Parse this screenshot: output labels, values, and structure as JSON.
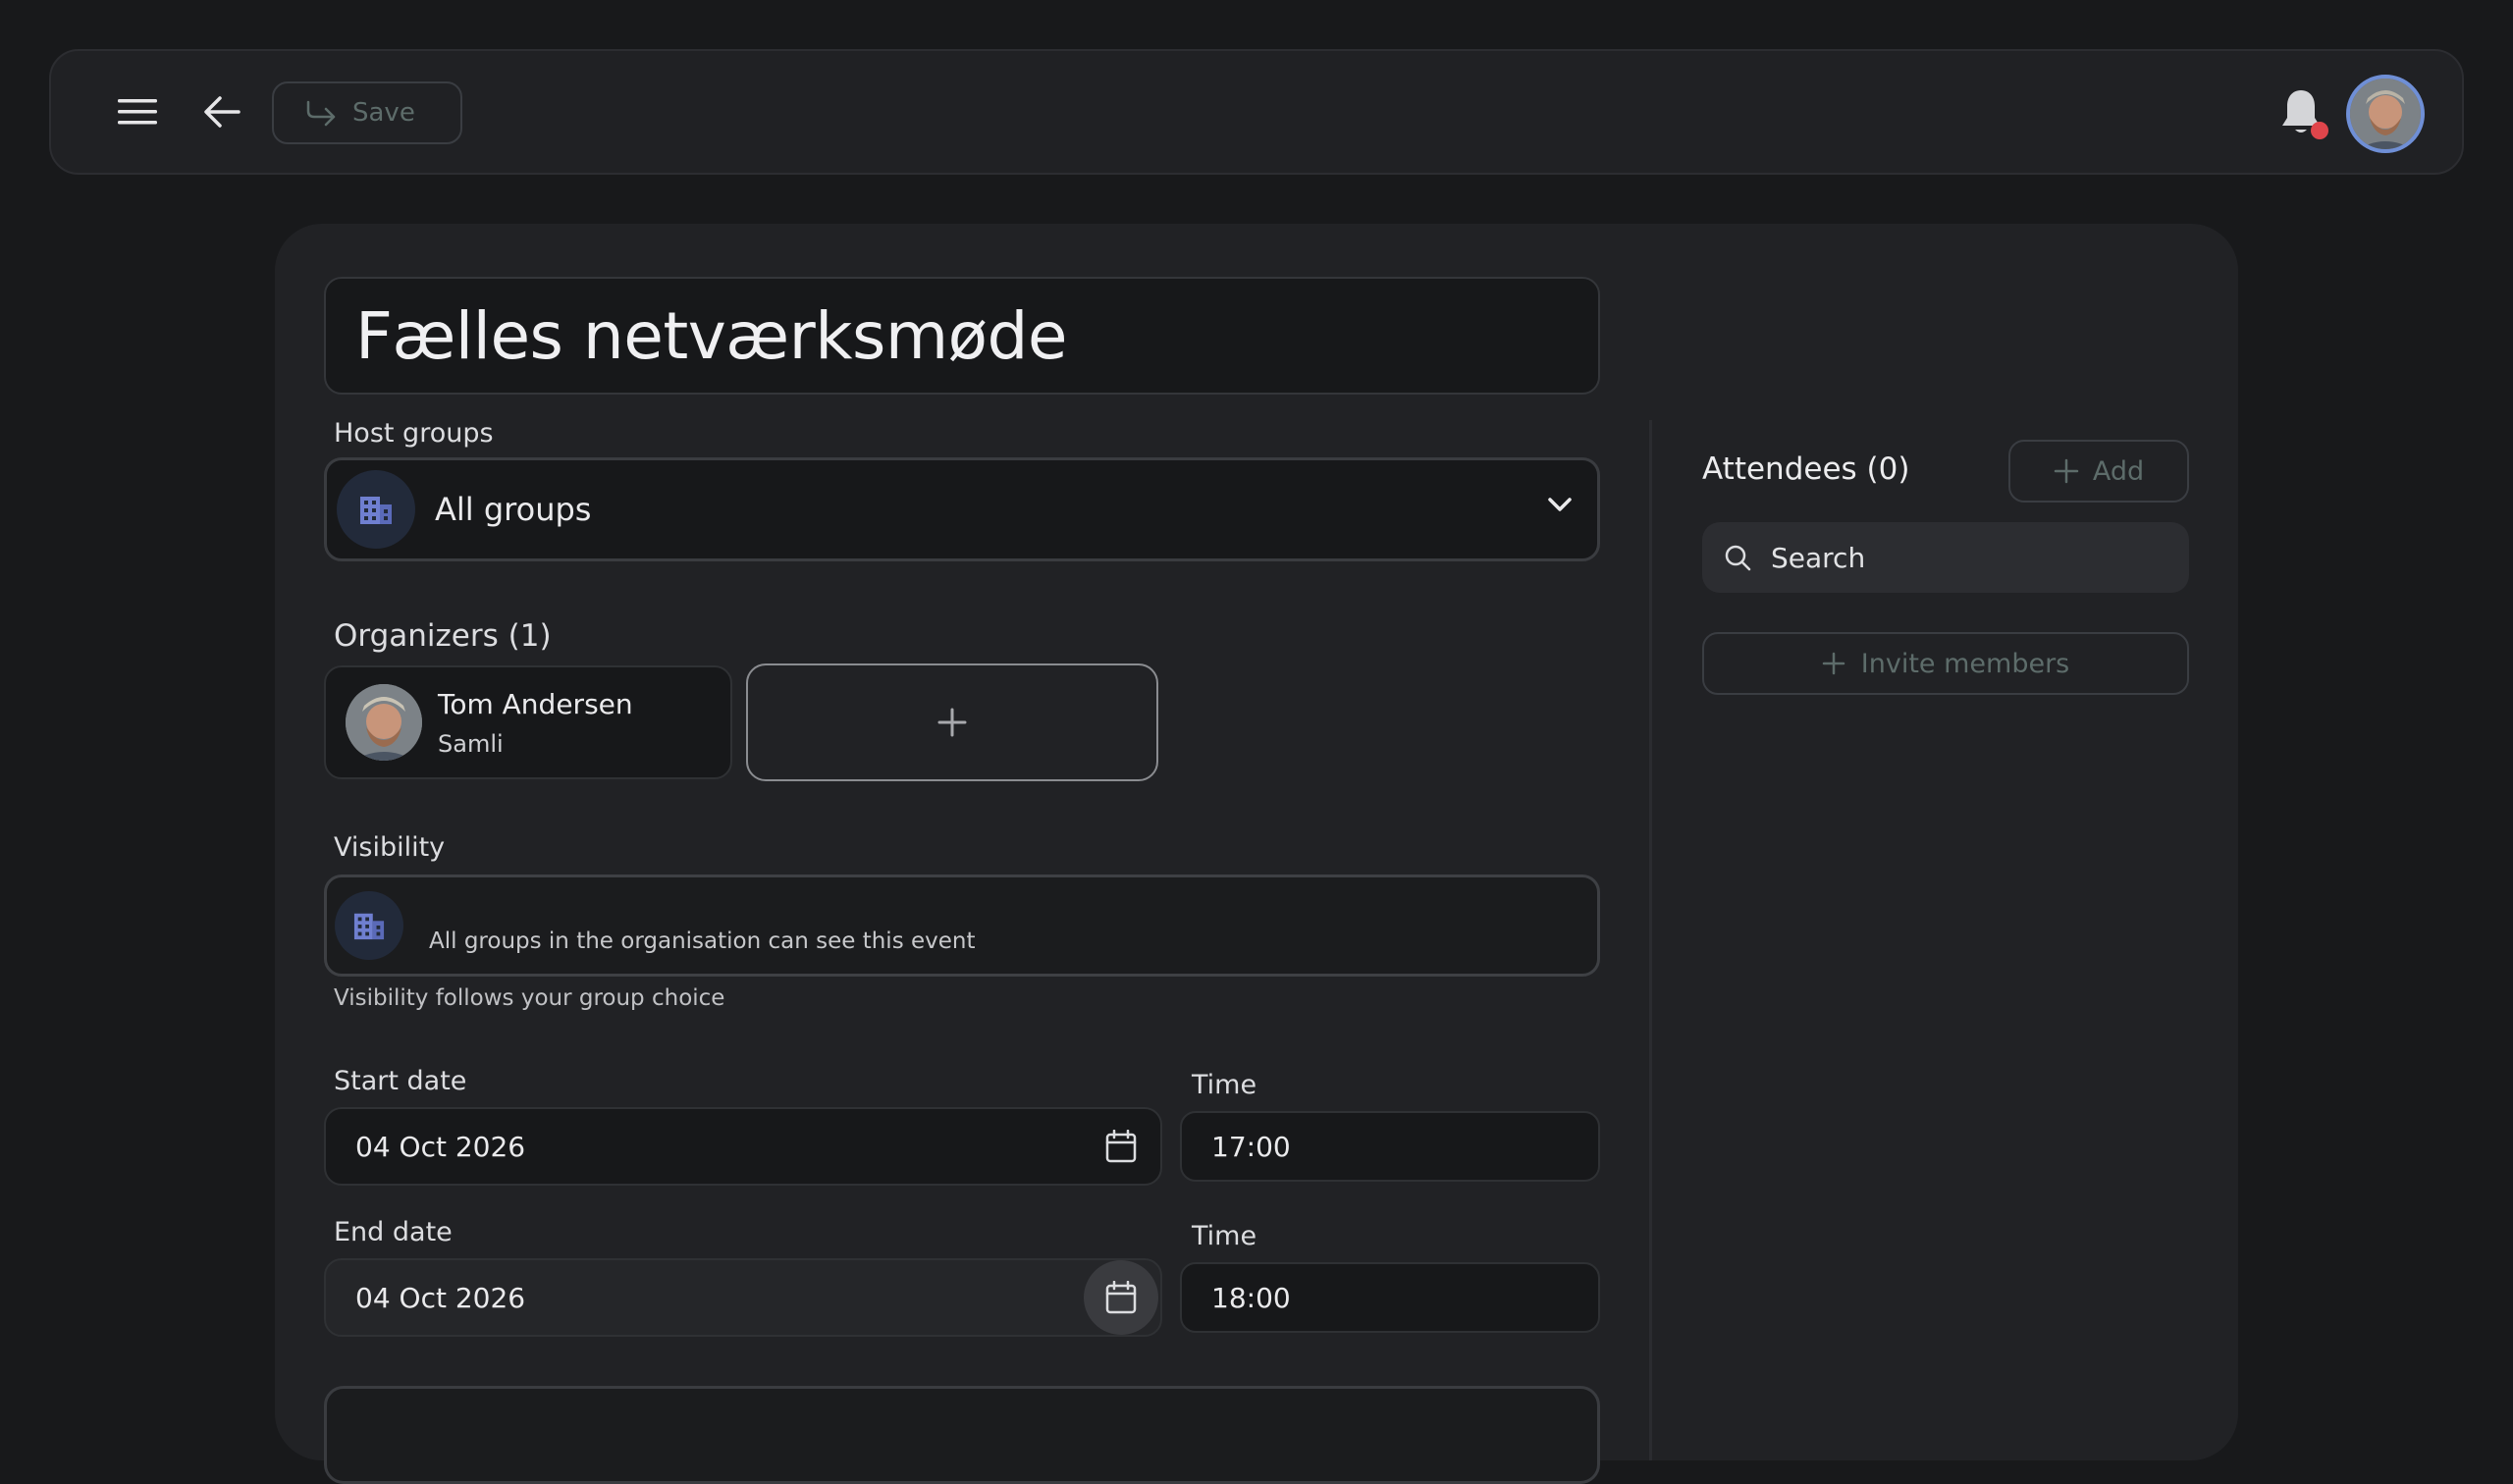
{
  "topbar": {
    "save_label": "Save",
    "menu_icon": "hamburger-menu-icon",
    "back_icon": "arrow-left-icon",
    "notification_icon": "bell-icon",
    "notification_dot_color": "#e0454b"
  },
  "event": {
    "title": "Fælles netværksmøde"
  },
  "host_groups": {
    "label": "Host groups",
    "selected": "All groups"
  },
  "organizers": {
    "label": "Organizers (1)",
    "items": [
      {
        "name": "Tom Andersen",
        "group": "Samli"
      }
    ]
  },
  "visibility": {
    "label": "Visibility",
    "text": "All groups in the organisation can see this event",
    "helper": "Visibility follows your group choice"
  },
  "start": {
    "date_label": "Start date",
    "date_value": "04 Oct 2026",
    "time_label": "Time",
    "time_value": "17:00"
  },
  "end": {
    "date_label": "End date",
    "date_value": "04 Oct 2026",
    "time_label": "Time",
    "time_value": "18:00"
  },
  "attendees": {
    "title": "Attendees (0)",
    "add_label": "Add",
    "search_placeholder": "Search",
    "invite_label": "Invite members"
  },
  "colors": {
    "accent_blue": "#6f8fd6",
    "muted_green_text": "#5d6c6a"
  }
}
